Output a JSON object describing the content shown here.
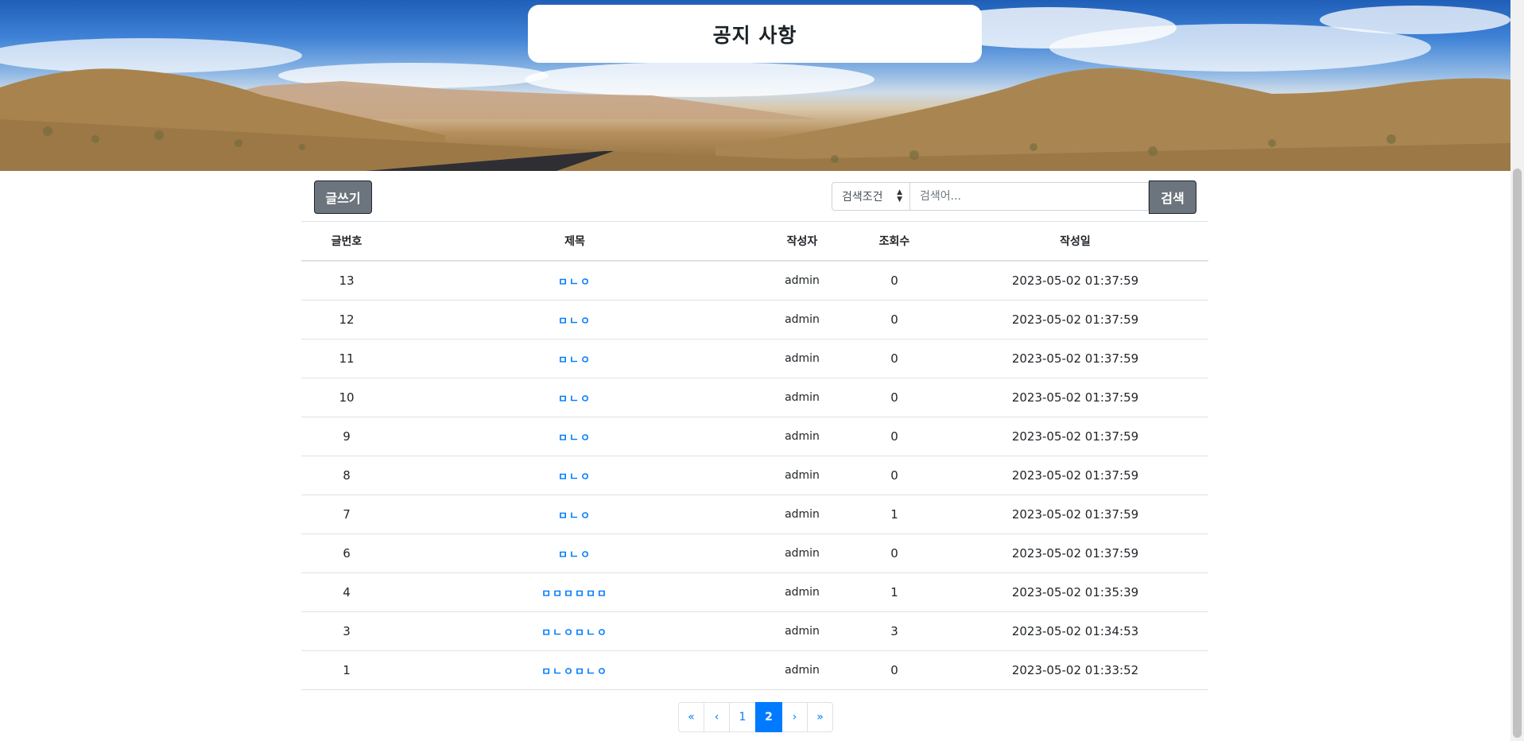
{
  "header": {
    "title": "공지 사항"
  },
  "toolbar": {
    "write_label": "글쓰기",
    "search_condition": "검색조건",
    "search_placeholder": "검색어...",
    "search_label": "검색"
  },
  "table": {
    "headers": {
      "no": "글번호",
      "title": "제목",
      "author": "작성자",
      "views": "조회수",
      "date": "작성일"
    },
    "rows": [
      {
        "no": "13",
        "title": "ㅁㄴㅇ",
        "author": "admin",
        "views": "0",
        "date": "2023-05-02 01:37:59"
      },
      {
        "no": "12",
        "title": "ㅁㄴㅇ",
        "author": "admin",
        "views": "0",
        "date": "2023-05-02 01:37:59"
      },
      {
        "no": "11",
        "title": "ㅁㄴㅇ",
        "author": "admin",
        "views": "0",
        "date": "2023-05-02 01:37:59"
      },
      {
        "no": "10",
        "title": "ㅁㄴㅇ",
        "author": "admin",
        "views": "0",
        "date": "2023-05-02 01:37:59"
      },
      {
        "no": "9",
        "title": "ㅁㄴㅇ",
        "author": "admin",
        "views": "0",
        "date": "2023-05-02 01:37:59"
      },
      {
        "no": "8",
        "title": "ㅁㄴㅇ",
        "author": "admin",
        "views": "0",
        "date": "2023-05-02 01:37:59"
      },
      {
        "no": "7",
        "title": "ㅁㄴㅇ",
        "author": "admin",
        "views": "1",
        "date": "2023-05-02 01:37:59"
      },
      {
        "no": "6",
        "title": "ㅁㄴㅇ",
        "author": "admin",
        "views": "0",
        "date": "2023-05-02 01:37:59"
      },
      {
        "no": "4",
        "title": "ㅁㅁㅁㅁㅁㅁ",
        "author": "admin",
        "views": "1",
        "date": "2023-05-02 01:35:39"
      },
      {
        "no": "3",
        "title": "ㅁㄴㅇㅁㄴㅇ",
        "author": "admin",
        "views": "3",
        "date": "2023-05-02 01:34:53"
      },
      {
        "no": "1",
        "title": "ㅁㄴㅇㅁㄴㅇ",
        "author": "admin",
        "views": "0",
        "date": "2023-05-02 01:33:52"
      }
    ]
  },
  "pagination": {
    "first": "«",
    "prev": "‹",
    "pages": [
      {
        "label": "1",
        "active": false
      },
      {
        "label": "2",
        "active": true
      }
    ],
    "next": "›",
    "last": "»"
  },
  "colors": {
    "accent": "#007bff",
    "button_gray": "#6c757d",
    "border": "#dee2e6"
  }
}
